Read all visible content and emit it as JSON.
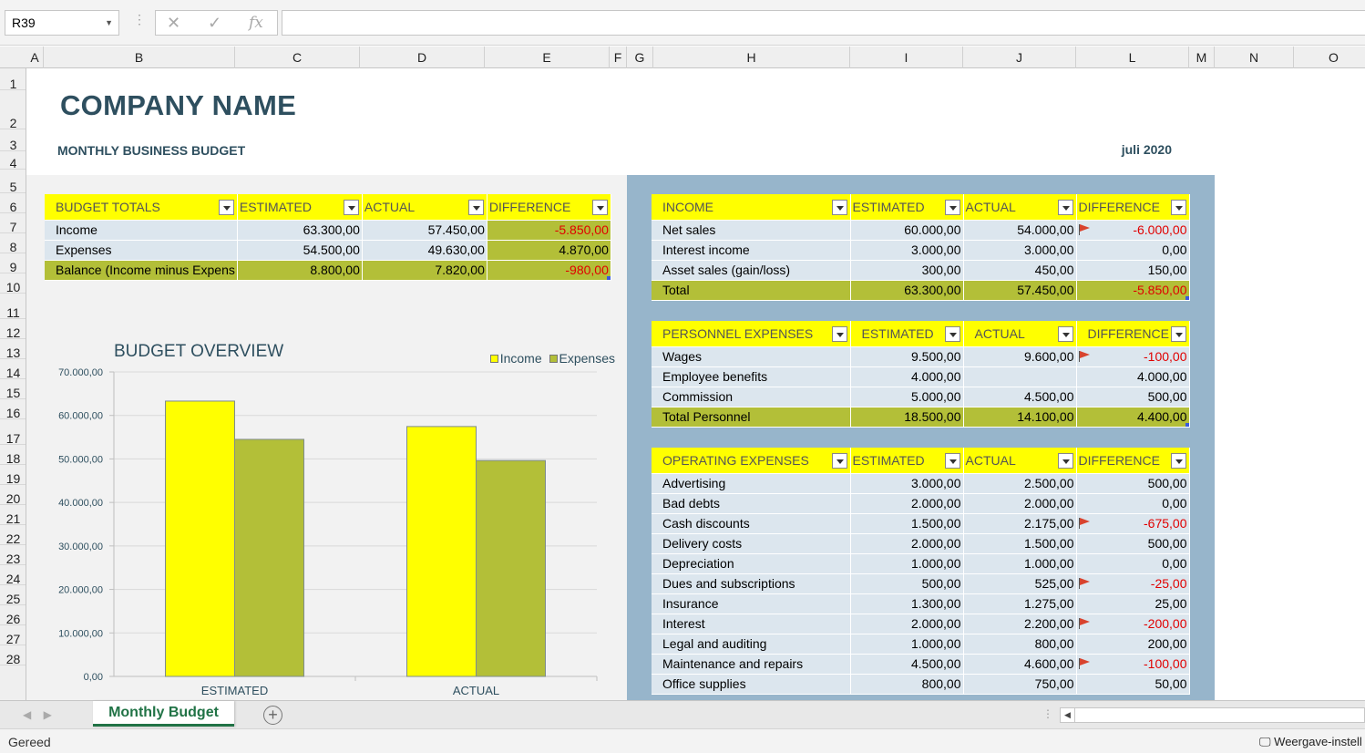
{
  "formula_bar": {
    "name_box": "R39",
    "cancel_icon": "✕",
    "enter_icon": "✓",
    "fx_icon": "fx",
    "formula": ""
  },
  "columns": [
    "A",
    "B",
    "C",
    "D",
    "E",
    "F",
    "G",
    "H",
    "I",
    "J",
    "L",
    "M",
    "N",
    "O"
  ],
  "rows": [
    "1",
    "2",
    "3",
    "4",
    "5",
    "6",
    "7",
    "8",
    "9",
    "10",
    "11",
    "12",
    "13",
    "14",
    "15",
    "16",
    "17",
    "18",
    "19",
    "20",
    "21",
    "22",
    "23",
    "24",
    "25",
    "26",
    "27",
    "28"
  ],
  "header": {
    "company": "COMPANY NAME",
    "subtitle": "MONTHLY BUSINESS BUDGET",
    "month": "juli 2020"
  },
  "budget_totals": {
    "headers": [
      "BUDGET TOTALS",
      "ESTIMATED",
      "ACTUAL",
      "DIFFERENCE"
    ],
    "rows": [
      {
        "label": "Income",
        "estimated": "63.300,00",
        "actual": "57.450,00",
        "difference": "-5.850,00",
        "neg": true
      },
      {
        "label": "Expenses",
        "estimated": "54.500,00",
        "actual": "49.630,00",
        "difference": "4.870,00",
        "neg": false
      }
    ],
    "balance": {
      "label": "Balance (Income minus Expens",
      "estimated": "8.800,00",
      "actual": "7.820,00",
      "difference": "-980,00",
      "neg": true
    }
  },
  "income": {
    "headers": [
      "INCOME",
      "ESTIMATED",
      "ACTUAL",
      "DIFFERENCE"
    ],
    "rows": [
      {
        "label": "Net sales",
        "estimated": "60.000,00",
        "actual": "54.000,00",
        "difference": "-6.000,00",
        "neg": true,
        "flag": true
      },
      {
        "label": "Interest income",
        "estimated": "3.000,00",
        "actual": "3.000,00",
        "difference": "0,00",
        "neg": false,
        "flag": false
      },
      {
        "label": "Asset sales (gain/loss)",
        "estimated": "300,00",
        "actual": "450,00",
        "difference": "150,00",
        "neg": false,
        "flag": false
      }
    ],
    "total": {
      "label": "Total",
      "estimated": "63.300,00",
      "actual": "57.450,00",
      "difference": "-5.850,00",
      "neg": true
    }
  },
  "personnel": {
    "headers": [
      "PERSONNEL EXPENSES",
      "ESTIMATED",
      "ACTUAL",
      "DIFFERENCE"
    ],
    "rows": [
      {
        "label": "Wages",
        "estimated": "9.500,00",
        "actual": "9.600,00",
        "difference": "-100,00",
        "neg": true,
        "flag": true
      },
      {
        "label": "Employee benefits",
        "estimated": "4.000,00",
        "actual": "",
        "difference": "4.000,00",
        "neg": false,
        "flag": false
      },
      {
        "label": "Commission",
        "estimated": "5.000,00",
        "actual": "4.500,00",
        "difference": "500,00",
        "neg": false,
        "flag": false
      }
    ],
    "total": {
      "label": "Total Personnel",
      "estimated": "18.500,00",
      "actual": "14.100,00",
      "difference": "4.400,00",
      "neg": false
    }
  },
  "operating": {
    "headers": [
      "OPERATING EXPENSES",
      "ESTIMATED",
      "ACTUAL",
      "DIFFERENCE"
    ],
    "rows": [
      {
        "label": "Advertising",
        "estimated": "3.000,00",
        "actual": "2.500,00",
        "difference": "500,00",
        "neg": false,
        "flag": false
      },
      {
        "label": "Bad debts",
        "estimated": "2.000,00",
        "actual": "2.000,00",
        "difference": "0,00",
        "neg": false,
        "flag": false
      },
      {
        "label": "Cash discounts",
        "estimated": "1.500,00",
        "actual": "2.175,00",
        "difference": "-675,00",
        "neg": true,
        "flag": true
      },
      {
        "label": "Delivery costs",
        "estimated": "2.000,00",
        "actual": "1.500,00",
        "difference": "500,00",
        "neg": false,
        "flag": false
      },
      {
        "label": "Depreciation",
        "estimated": "1.000,00",
        "actual": "1.000,00",
        "difference": "0,00",
        "neg": false,
        "flag": false
      },
      {
        "label": "Dues and subscriptions",
        "estimated": "500,00",
        "actual": "525,00",
        "difference": "-25,00",
        "neg": true,
        "flag": true
      },
      {
        "label": "Insurance",
        "estimated": "1.300,00",
        "actual": "1.275,00",
        "difference": "25,00",
        "neg": false,
        "flag": false
      },
      {
        "label": "Interest",
        "estimated": "2.000,00",
        "actual": "2.200,00",
        "difference": "-200,00",
        "neg": true,
        "flag": true
      },
      {
        "label": "Legal and auditing",
        "estimated": "1.000,00",
        "actual": "800,00",
        "difference": "200,00",
        "neg": false,
        "flag": false
      },
      {
        "label": "Maintenance and repairs",
        "estimated": "4.500,00",
        "actual": "4.600,00",
        "difference": "-100,00",
        "neg": true,
        "flag": true
      },
      {
        "label": "Office supplies",
        "estimated": "800,00",
        "actual": "750,00",
        "difference": "50,00",
        "neg": false,
        "flag": false
      }
    ]
  },
  "chart_data": {
    "type": "bar",
    "title": "BUDGET OVERVIEW",
    "categories": [
      "ESTIMATED",
      "ACTUAL"
    ],
    "series": [
      {
        "name": "Income",
        "values": [
          63300,
          57450
        ],
        "color": "#ffff00"
      },
      {
        "name": "Expenses",
        "values": [
          54500,
          49630
        ],
        "color": "#b3bf38"
      }
    ],
    "ylim": [
      0,
      70000
    ],
    "yticks": [
      "0,00",
      "10.000,00",
      "20.000,00",
      "30.000,00",
      "40.000,00",
      "50.000,00",
      "60.000,00",
      "70.000,00"
    ],
    "grid": true,
    "legend": "top-right"
  },
  "colors": {
    "header_yellow": "#ffff00",
    "total_green": "#b3bf38",
    "row_blue": "#dce6ee",
    "panel_blue": "#97b5cb",
    "title_teal": "#2e4f5f",
    "negative_red": "#e00000"
  },
  "sheet_tab": "Monthly Budget",
  "status": {
    "text": "Gereed",
    "view_settings": "Weergave-instell"
  }
}
